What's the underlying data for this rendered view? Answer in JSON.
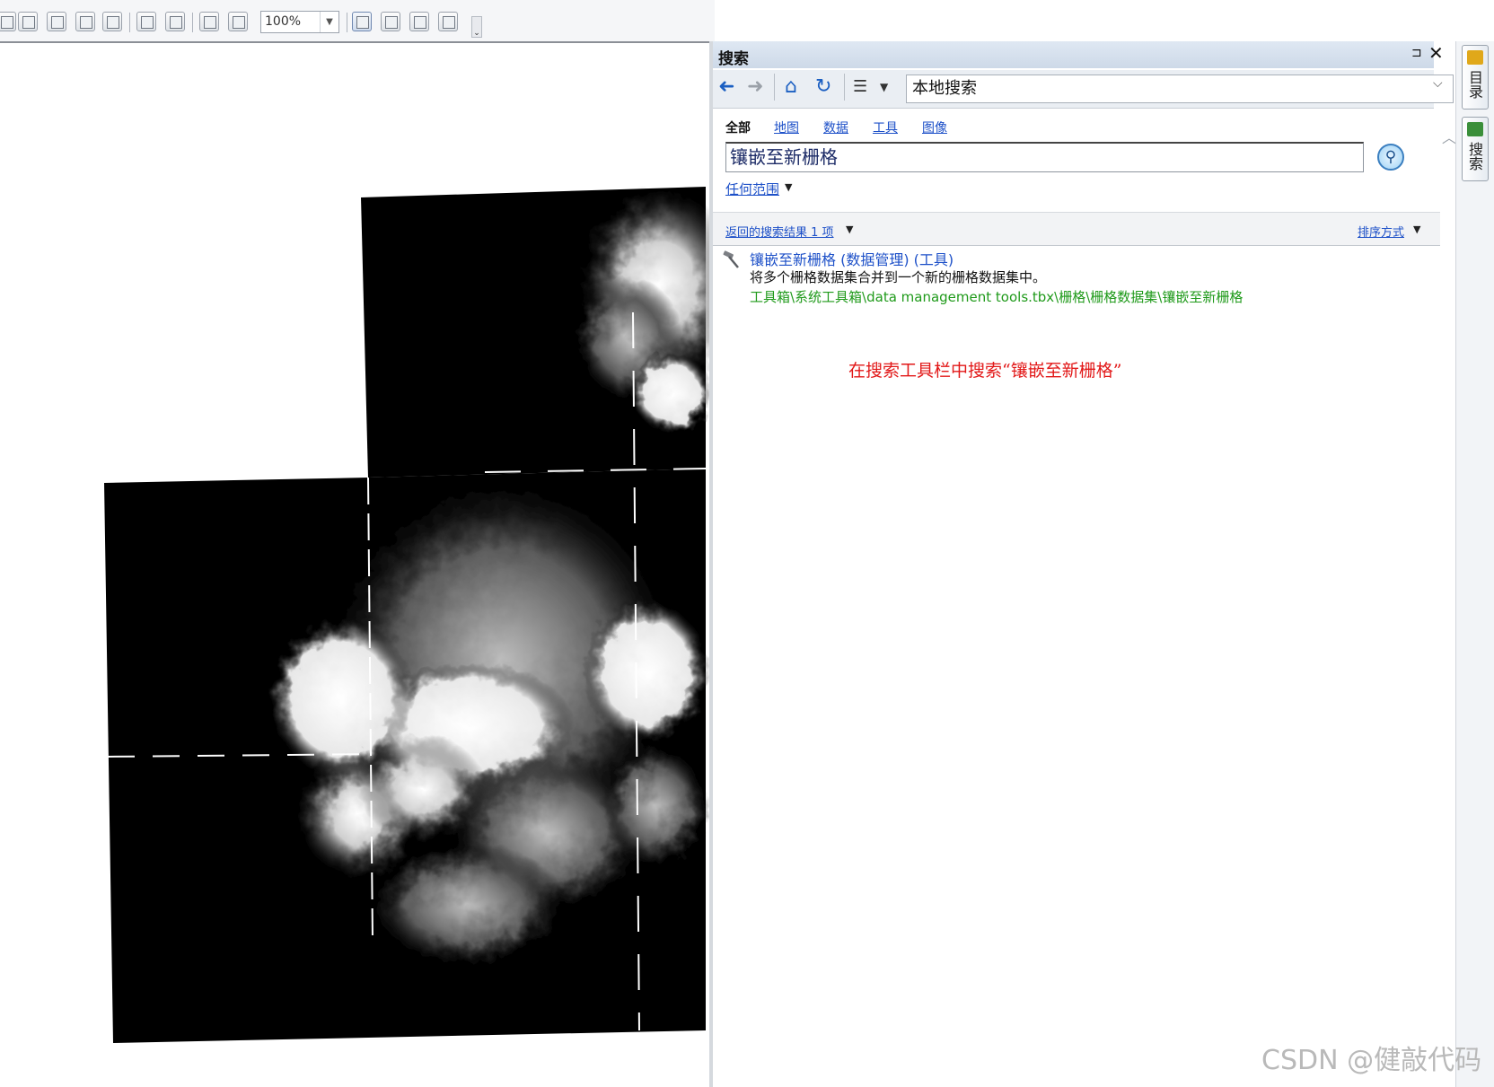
{
  "toolbar": {
    "zoom_value": "100%",
    "overflow_glyph": "⌄"
  },
  "map": {
    "description_colors": {
      "raster_black": "#000000",
      "terrain_light": "#f2f2f2",
      "background": "#ffffff"
    }
  },
  "panel": {
    "title": "搜索",
    "pin_glyph": "⊐",
    "close_glyph": "✕",
    "scope": "本地搜索",
    "filter_tabs": [
      "全部",
      "地图",
      "数据",
      "工具",
      "图像"
    ],
    "search_text": "镶嵌至新栅格",
    "scope_link": "任何范围",
    "results_count": "返回的搜索结果 1 项",
    "sort_label": "排序方式",
    "result": {
      "title": "镶嵌至新栅格 (数据管理) (工具)",
      "description": "将多个栅格数据集合并到一个新的栅格数据集中。",
      "path": "工具箱\\系统工具箱\\data management tools.tbx\\栅格\\栅格数据集\\镶嵌至新栅格"
    },
    "annotation": "在搜索工具栏中搜索“镶嵌至新栅格”"
  },
  "side_dock": {
    "tabs": [
      {
        "label": "目录",
        "icon": "catalog-icon",
        "color": "#e0a81a"
      },
      {
        "label": "搜索",
        "icon": "search-window-icon",
        "color": "#3a8f3a"
      }
    ]
  },
  "watermark": "CSDN @健敲代码",
  "colors": {
    "link": "#1d50c8",
    "path_green": "#1f9a1a",
    "annotation_red": "#e21818",
    "title_bar": "#cdd9e8"
  }
}
